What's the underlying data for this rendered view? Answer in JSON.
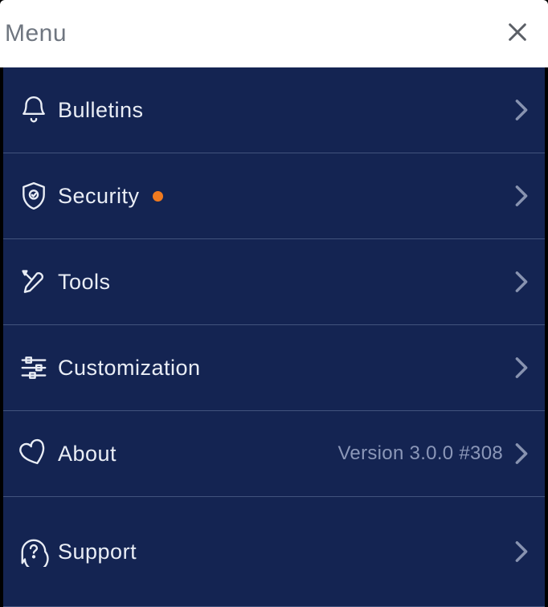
{
  "header": {
    "title": "Menu"
  },
  "items": [
    {
      "label": "Bulletins",
      "badge": false,
      "trailing": ""
    },
    {
      "label": "Security",
      "badge": true,
      "trailing": ""
    },
    {
      "label": "Tools",
      "badge": false,
      "trailing": ""
    },
    {
      "label": "Customization",
      "badge": false,
      "trailing": ""
    },
    {
      "label": "About",
      "badge": false,
      "trailing": "Version 3.0.0 #308"
    },
    {
      "label": "Support",
      "badge": false,
      "trailing": ""
    }
  ],
  "colors": {
    "accent": "#f07a1f",
    "bg": "#142452"
  }
}
